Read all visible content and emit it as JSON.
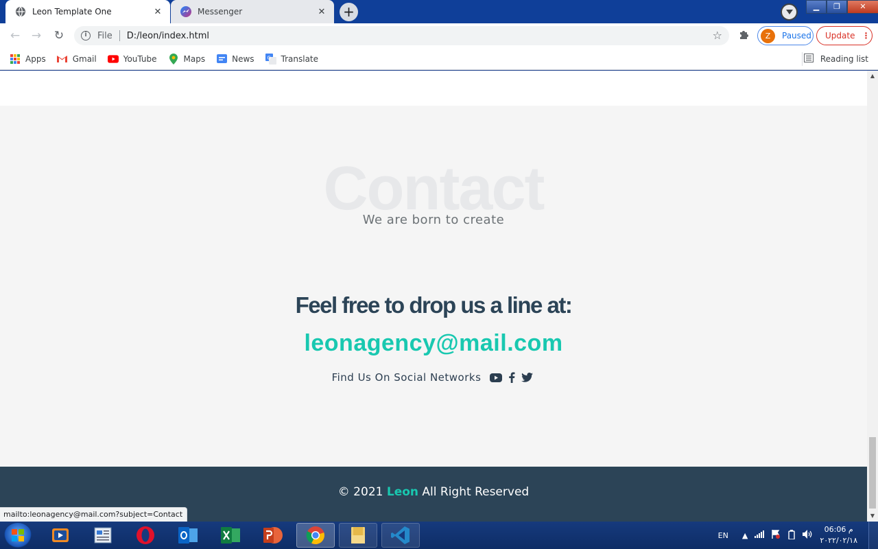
{
  "browser": {
    "tabs": [
      {
        "title": "Leon Template One",
        "active": true
      },
      {
        "title": "Messenger",
        "active": false
      }
    ],
    "new_tab_label": "+",
    "address": {
      "scheme": "File",
      "url": "D:/leon/index.html"
    },
    "profile": {
      "initial": "Z",
      "status": "Paused"
    },
    "update_label": "Update",
    "bookmarks": [
      {
        "label": "Apps",
        "icon": "apps-grid-icon"
      },
      {
        "label": "Gmail",
        "icon": "gmail-icon"
      },
      {
        "label": "YouTube",
        "icon": "youtube-icon"
      },
      {
        "label": "Maps",
        "icon": "maps-icon"
      },
      {
        "label": "News",
        "icon": "news-icon"
      },
      {
        "label": "Translate",
        "icon": "translate-icon"
      }
    ],
    "reading_list_label": "Reading list",
    "status_url": "mailto:leonagency@mail.com?subject=Contact"
  },
  "page": {
    "contact": {
      "ghost_title": "Contact",
      "subtitle": "We are born to create",
      "heading": "Feel free to drop us a line at:",
      "email": "leonagency@mail.com",
      "social_label": "Find Us On Social Networks",
      "social_icons": [
        "youtube-icon",
        "facebook-icon",
        "twitter-icon"
      ]
    },
    "footer": {
      "prefix": "© 2021",
      "brand": "Leon",
      "suffix": "All Right Reserved"
    }
  },
  "colors": {
    "accent": "#19c8b0",
    "heading": "#2c4457",
    "footer_bg": "#2c4457",
    "section_bg": "#f5f5f5"
  },
  "taskbar": {
    "apps": [
      "media-player-icon",
      "document-viewer-icon",
      "opera-icon",
      "outlook-icon",
      "excel-icon",
      "powerpoint-icon",
      "chrome-icon",
      "file-explorer-icon",
      "vscode-icon"
    ],
    "language": "EN",
    "time": "06:06 م",
    "date": "٢٠٢٢/٠٢/١٨"
  }
}
